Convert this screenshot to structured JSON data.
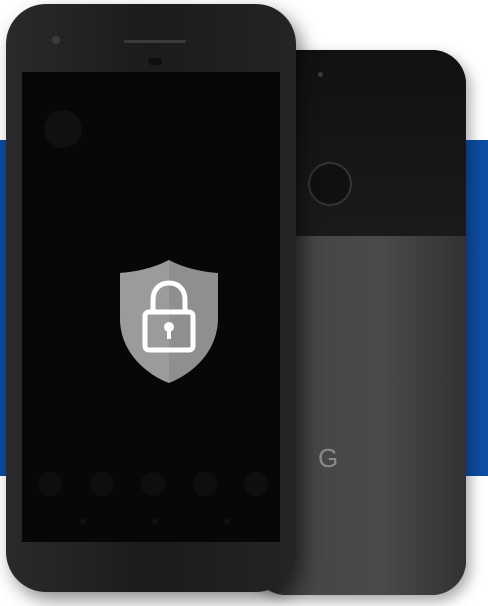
{
  "scene": {
    "background_color": "#ffffff",
    "band_color": "#1556b3"
  },
  "back_phone": {
    "logo_letter": "G",
    "body_color": "#474546",
    "glass_color": "#111112"
  },
  "front_phone": {
    "screen_color": "#060708",
    "body_color": "#1b1b1d",
    "lock_icon": "shield-padlock-icon",
    "shield_color": "#8f8f92",
    "padlock_color": "#ffffff"
  }
}
